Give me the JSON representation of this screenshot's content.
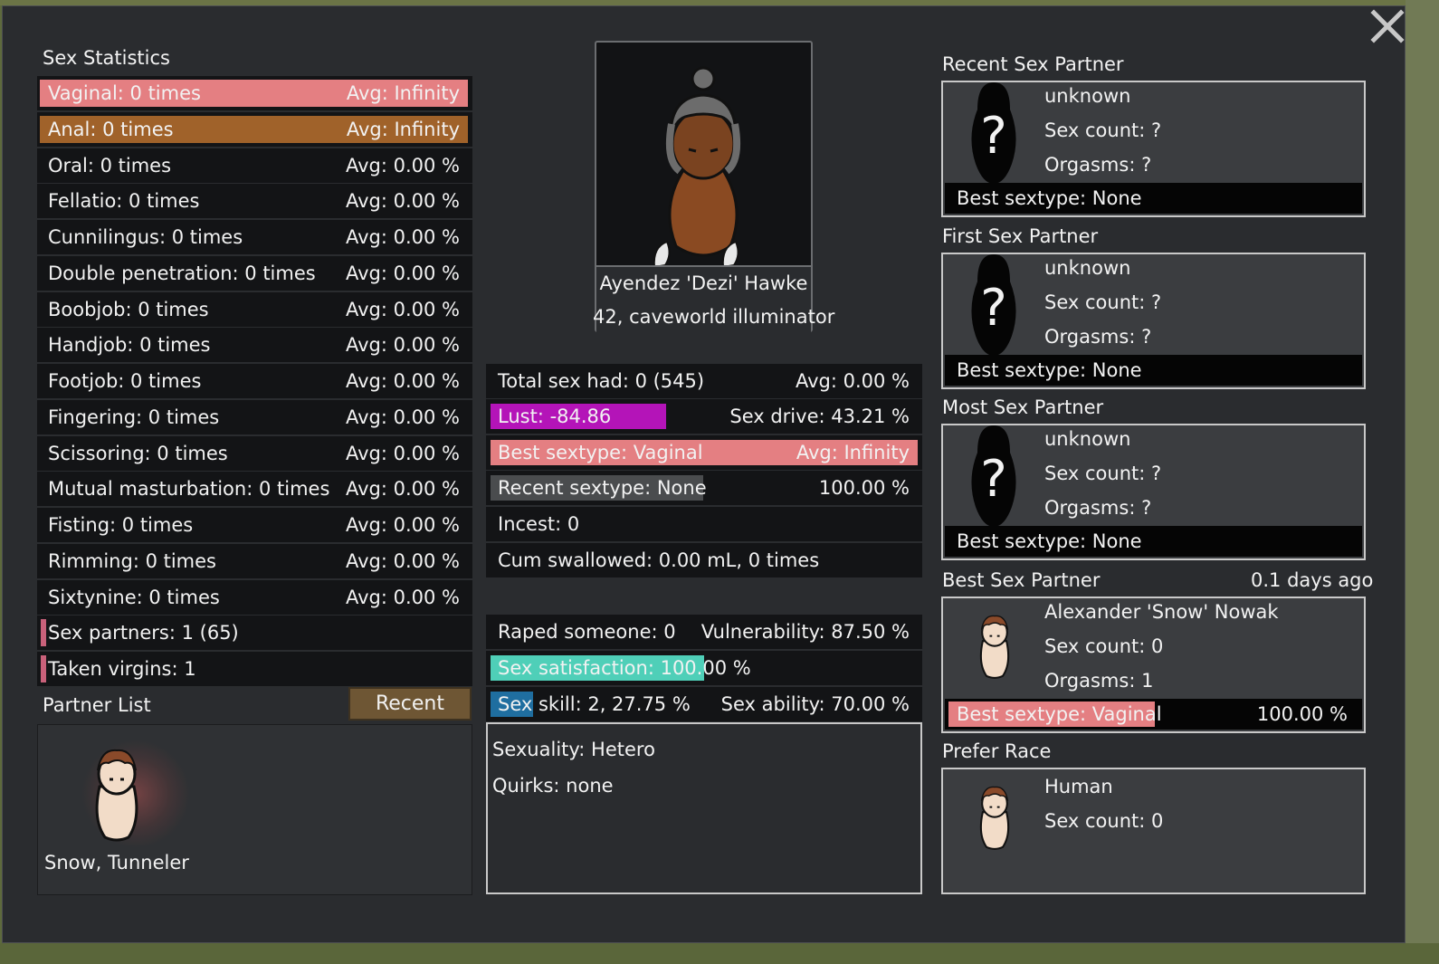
{
  "colors": {
    "vaginal": "#e47f82",
    "anal": "#a0622a",
    "lust": "#b414b8",
    "best_sextype": "#e47f82",
    "recent_sextype": "#4a4c4e",
    "satisfaction": "#4fcfb8",
    "skill": "#1f6ea0",
    "partner_mark": "#c9617a",
    "recent_button": "#6e5634"
  },
  "left": {
    "title": "Sex Statistics",
    "stats": [
      {
        "label": "Vaginal: 0 times",
        "avg": "Avg: Infinity",
        "highlight": "vaginal"
      },
      {
        "label": "Anal: 0 times",
        "avg": "Avg: Infinity",
        "highlight": "anal"
      },
      {
        "label": "Oral: 0 times",
        "avg": "Avg: 0.00 %"
      },
      {
        "label": "Fellatio: 0 times",
        "avg": "Avg: 0.00 %"
      },
      {
        "label": "Cunnilingus: 0 times",
        "avg": "Avg: 0.00 %"
      },
      {
        "label": "Double penetration: 0 times",
        "avg": "Avg: 0.00 %"
      },
      {
        "label": "Boobjob: 0 times",
        "avg": "Avg: 0.00 %"
      },
      {
        "label": "Handjob: 0 times",
        "avg": "Avg: 0.00 %"
      },
      {
        "label": "Footjob: 0 times",
        "avg": "Avg: 0.00 %"
      },
      {
        "label": "Fingering: 0 times",
        "avg": "Avg: 0.00 %"
      },
      {
        "label": "Scissoring: 0 times",
        "avg": "Avg: 0.00 %"
      },
      {
        "label": "Mutual masturbation: 0 times",
        "avg": "Avg: 0.00 %"
      },
      {
        "label": "Fisting: 0 times",
        "avg": "Avg: 0.00 %"
      },
      {
        "label": "Rimming: 0 times",
        "avg": "Avg: 0.00 %"
      },
      {
        "label": "Sixtynine: 0 times",
        "avg": "Avg: 0.00 %"
      }
    ],
    "sex_partners": "Sex partners: 1 (65)",
    "taken_virgins": "Taken virgins: 1",
    "partner_list_title": "Partner List",
    "recent_button": "Recent",
    "partner_name": "Snow, Tunneler"
  },
  "center": {
    "pawn_name": "Ayendez 'Dezi' Hawke",
    "pawn_desc": "42, caveworld illuminator",
    "total_sex": "Total sex had: 0 (545)",
    "total_avg": "Avg: 0.00 %",
    "lust": "Lust: -84.86",
    "lust_fill": 0.41,
    "sex_drive": "Sex drive: 43.21 %",
    "best_sextype": "Best sextype: Vaginal",
    "best_avg": "Avg: Infinity",
    "recent_sextype": "Recent sextype: None",
    "recent_pct": "100.00 %",
    "incest": "Incest: 0",
    "cum": "Cum swallowed: 0.00 mL, 0 times",
    "raped": "Raped someone: 0",
    "vulnerability": "Vulnerability: 87.50 %",
    "satisfaction": "Sex satisfaction: 100.00 %",
    "satisfaction_fill": 0.5,
    "skill": "Sex skill: 2, 27.75 %",
    "skill_fill": 0.1,
    "ability": "Sex ability: 70.00 %",
    "sexuality": "Sexuality: Hetero",
    "quirks": "Quirks: none"
  },
  "right": {
    "recent": {
      "title": "Recent Sex Partner",
      "name": "unknown",
      "count": "Sex count: ?",
      "orgasms": "Orgasms: ?",
      "best": "Best sextype: None"
    },
    "first": {
      "title": "First Sex Partner",
      "name": "unknown",
      "count": "Sex count: ?",
      "orgasms": "Orgasms: ?",
      "best": "Best sextype: None"
    },
    "most": {
      "title": "Most Sex Partner",
      "name": "unknown",
      "count": "Sex count: ?",
      "orgasms": "Orgasms: ?",
      "best": "Best sextype: None"
    },
    "best": {
      "title": "Best Sex Partner",
      "ago": "0.1 days ago",
      "name": "Alexander 'Snow' Nowak",
      "count": "Sex count: 0",
      "orgasms": "Orgasms: 1",
      "best": "Best sextype: Vaginal",
      "best_pct": "100.00 %",
      "best_fill": 0.5
    },
    "race": {
      "title": "Prefer Race",
      "name": "Human",
      "count": "Sex count: 0"
    }
  },
  "icons": [
    "close-icon",
    "question-mark-icon",
    "pawn-portrait-icon"
  ]
}
